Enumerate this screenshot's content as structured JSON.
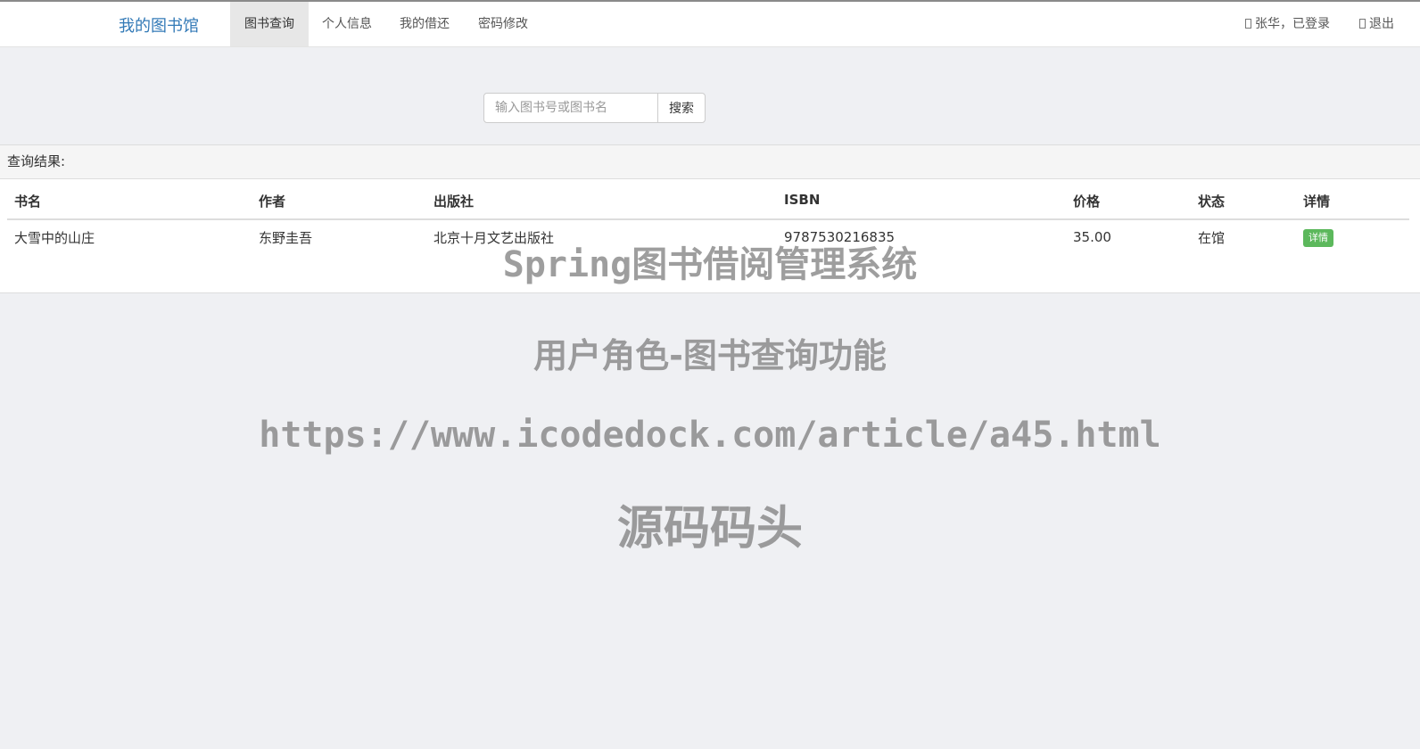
{
  "navbar": {
    "brand": "我的图书馆",
    "items": [
      {
        "label": "图书查询",
        "active": true
      },
      {
        "label": "个人信息",
        "active": false
      },
      {
        "label": "我的借还",
        "active": false
      },
      {
        "label": "密码修改",
        "active": false
      }
    ],
    "user_status": "张华，已登录",
    "logout": "退出"
  },
  "search": {
    "placeholder": "输入图书号或图书名",
    "value": "",
    "button": "搜索"
  },
  "results": {
    "heading": "查询结果:",
    "columns": [
      "书名",
      "作者",
      "出版社",
      "ISBN",
      "价格",
      "状态",
      "详情"
    ],
    "rows": [
      {
        "title": "大雪中的山庄",
        "author": "东野圭吾",
        "publisher": "北京十月文艺出版社",
        "isbn": "9787530216835",
        "price": "35.00",
        "status": "在馆",
        "detail_label": "详情"
      }
    ]
  },
  "watermark": {
    "line1": "Spring图书借阅管理系统",
    "line2": "用户角色-图书查询功能",
    "line3": "https://www.icodedock.com/article/a45.html",
    "line4": "源码码头"
  },
  "colors": {
    "brand": "#337ab7",
    "badge": "#5cb85c",
    "background": "#eff0f3"
  }
}
